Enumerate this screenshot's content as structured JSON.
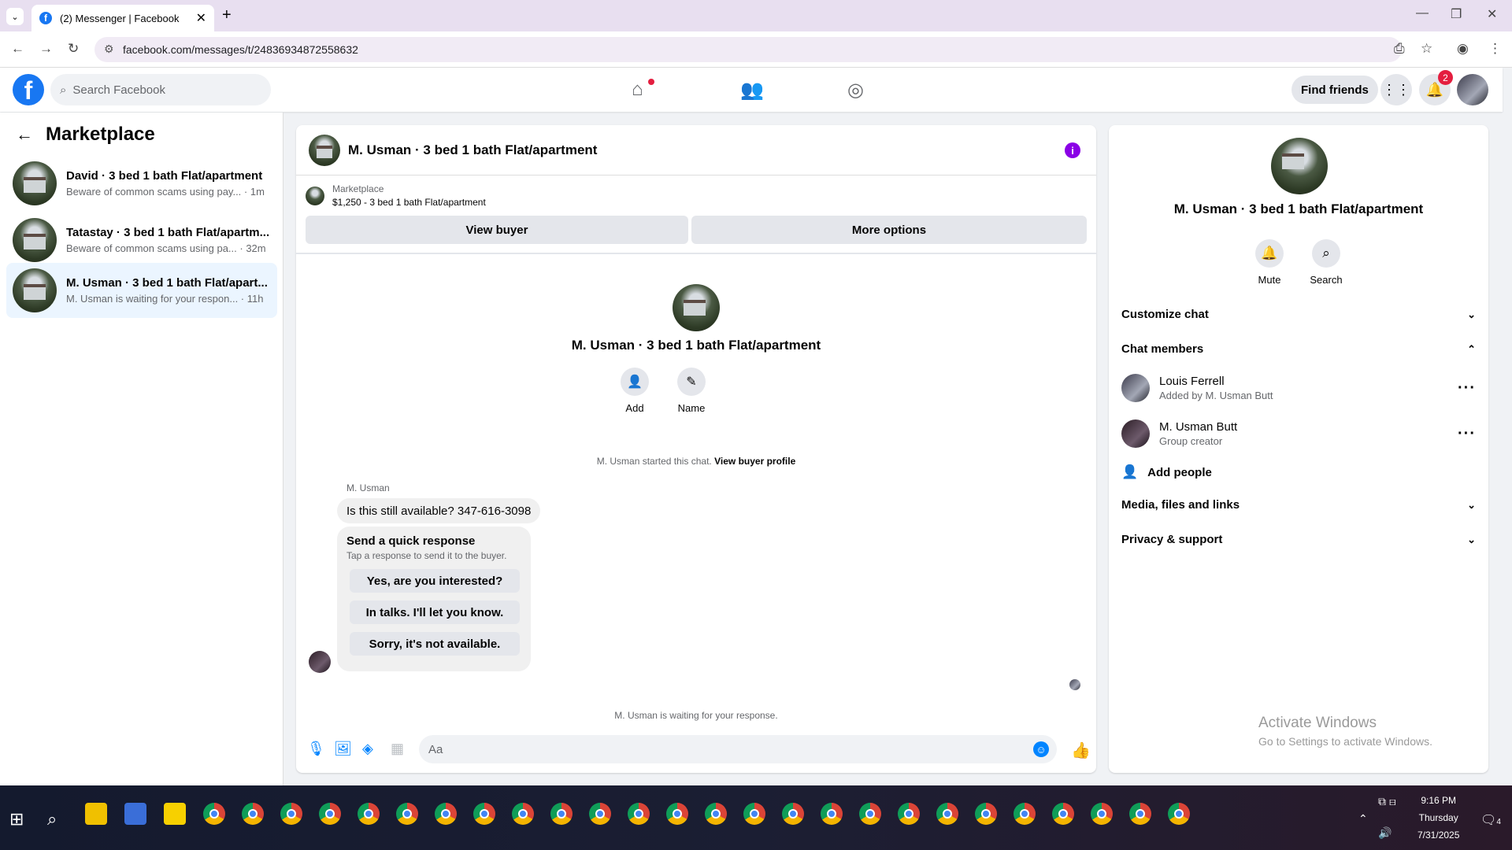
{
  "browser": {
    "tab_title": "(2) Messenger | Facebook",
    "url": "facebook.com/messages/t/24836934872558632"
  },
  "fb": {
    "search_placeholder": "Search Facebook",
    "find_friends": "Find friends",
    "notif_count": "2"
  },
  "sidebar": {
    "title": "Marketplace",
    "conversations": [
      {
        "name": "David · 3 bed 1 bath Flat/apartment",
        "preview": "Beware of common scams using pay... · 1m",
        "active": false
      },
      {
        "name": "Tatastay · 3 bed 1 bath Flat/apartm...",
        "preview": "Beware of common scams using pa... · 32m",
        "active": false
      },
      {
        "name": "M. Usman · 3 bed 1 bath Flat/apart...",
        "preview": "M. Usman is waiting for your respon... · 11h",
        "active": true
      }
    ]
  },
  "chat": {
    "title": "M. Usman · 3 bed 1 bath Flat/apartment",
    "listing_source": "Marketplace",
    "listing": "$1,250 - 3 bed 1 bath Flat/apartment",
    "view_buyer": "View buyer",
    "more_options": "More options",
    "center_title": "M. Usman · 3 bed 1 bath Flat/apartment",
    "add_label": "Add",
    "name_label": "Name",
    "started_text": "M. Usman started this chat.",
    "view_profile": "View buyer profile",
    "sender": "M. Usman",
    "message": "Is this still available? 347-616-3098",
    "quick_title": "Send a quick response",
    "quick_sub": "Tap a response to send it to the buyer.",
    "quick_responses": [
      "Yes, are you interested?",
      "In talks. I'll let you know.",
      "Sorry, it's not available."
    ],
    "waiting": "M. Usman is waiting for your response.",
    "input_placeholder": "Aa"
  },
  "details": {
    "title": "M. Usman · 3 bed 1 bath Flat/apartment",
    "mute": "Mute",
    "search": "Search",
    "customize": "Customize chat",
    "members_header": "Chat members",
    "members": [
      {
        "name": "Louis Ferrell",
        "role": "Added by M. Usman Butt"
      },
      {
        "name": "M. Usman Butt",
        "role": "Group creator"
      }
    ],
    "add_people": "Add people",
    "media": "Media, files and links",
    "privacy": "Privacy & support"
  },
  "watermark": {
    "line1": "Activate Windows",
    "line2": "Go to Settings to activate Windows."
  },
  "taskbar": {
    "time": "9:16 PM",
    "day": "Thursday",
    "date": "7/31/2025",
    "notif": "4"
  },
  "colors": {
    "fb_blue": "#1877f2",
    "messenger_blue": "#0084ff",
    "active_conv": "#ebf5ff",
    "info_purple": "#8a00e6"
  }
}
